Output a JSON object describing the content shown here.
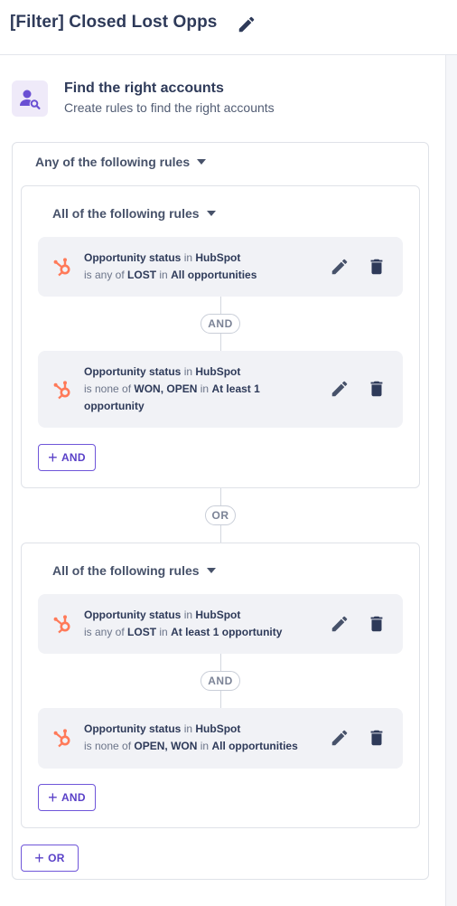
{
  "header": {
    "title": "[Filter] Closed Lost Opps"
  },
  "section": {
    "title": "Find the right accounts",
    "subtitle": "Create rules to find the right accounts"
  },
  "colors": {
    "accent": "#5a41c8",
    "hubspot": "#ff7a59",
    "rule_bg": "#f1f2f6"
  },
  "root": {
    "operator_label": "Any of the following rules",
    "connector": "OR",
    "add_label": "OR",
    "groups": [
      {
        "operator_label": "All of the following rules",
        "connector": "AND",
        "add_label": "AND",
        "rules": [
          {
            "field": "Opportunity status",
            "in_word": "in",
            "source": "HubSpot",
            "op": "is any of",
            "values": "LOST",
            "in2": "in",
            "scope": "All opportunities"
          },
          {
            "field": "Opportunity status",
            "in_word": "in",
            "source": "HubSpot",
            "op": "is none of",
            "values": "WON, OPEN",
            "in2": "in",
            "scope": "At least 1 opportunity"
          }
        ]
      },
      {
        "operator_label": "All of the following rules",
        "connector": "AND",
        "add_label": "AND",
        "rules": [
          {
            "field": "Opportunity status",
            "in_word": "in",
            "source": "HubSpot",
            "op": "is any of",
            "values": "LOST",
            "in2": "in",
            "scope": "At least 1 opportunity"
          },
          {
            "field": "Opportunity status",
            "in_word": "in",
            "source": "HubSpot",
            "op": "is none of",
            "values": "OPEN, WON",
            "in2": "in",
            "scope": "All opportunities"
          }
        ]
      }
    ]
  },
  "icons": {
    "edit": "pencil-icon",
    "delete": "trash-icon",
    "source": "hubspot-icon",
    "account": "account-search-icon",
    "caret": "caret-down-icon"
  }
}
